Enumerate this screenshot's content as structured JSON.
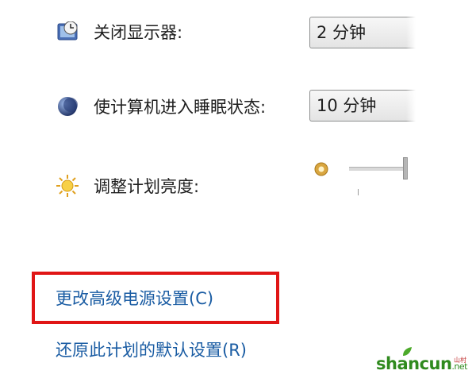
{
  "settings": {
    "display_off": {
      "label": "关闭显示器:",
      "value": "2 分钟",
      "icon": "display-clock-icon"
    },
    "sleep": {
      "label": "使计算机进入睡眠状态:",
      "value": "10 分钟",
      "icon": "moon-icon"
    },
    "brightness": {
      "label": "调整计划亮度:",
      "icon": "sun-icon",
      "slider_level_percent": 100
    }
  },
  "links": {
    "advanced": "更改高级电源设置(C)",
    "restore": "还原此计划的默认设置(R)"
  },
  "watermark": {
    "brand": "shancun",
    "suffix": ".net",
    "cjk": "山村"
  },
  "colors": {
    "link": "#1a5ca3",
    "highlight": "#e01515",
    "watermark": "#2f8a1e"
  }
}
